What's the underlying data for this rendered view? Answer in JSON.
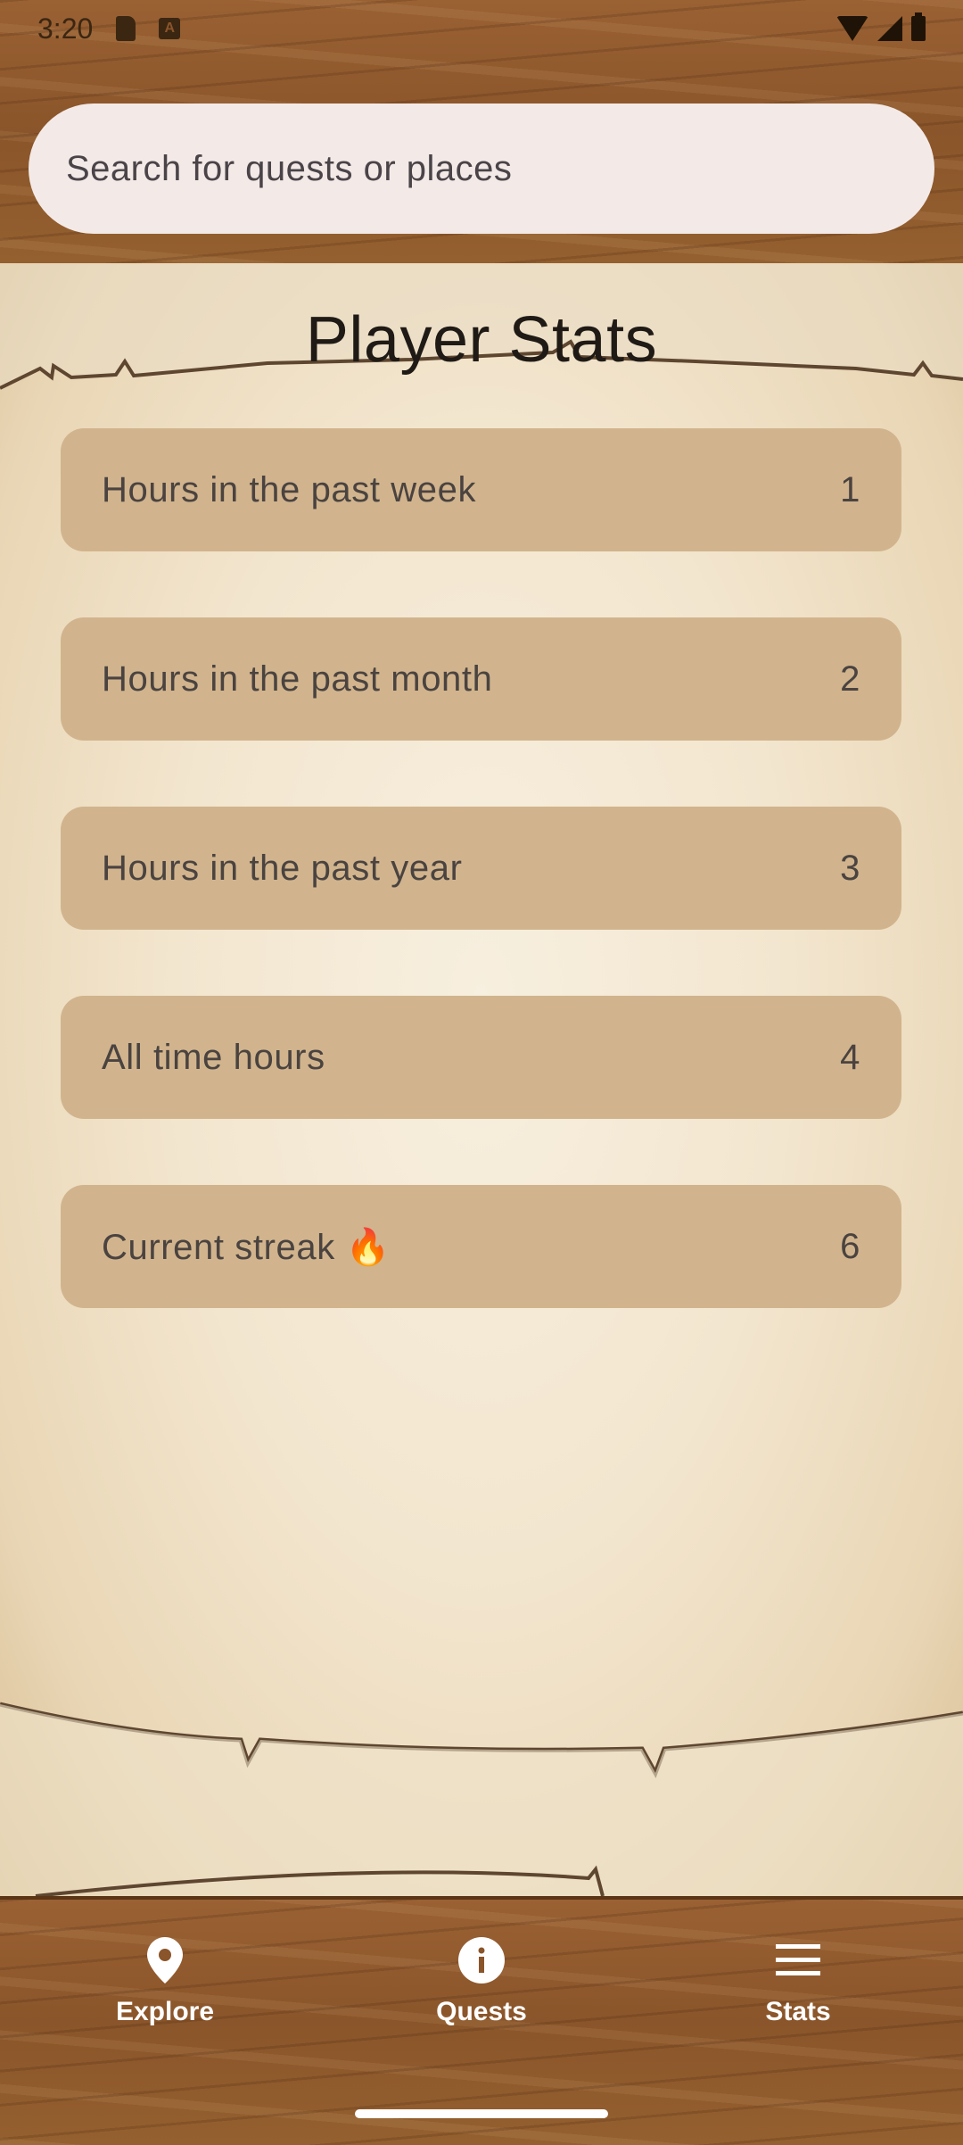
{
  "status_bar": {
    "time": "3:20"
  },
  "search": {
    "placeholder": "Search for quests or places"
  },
  "page": {
    "title": "Player Stats"
  },
  "stats": [
    {
      "label": "Hours in the past week",
      "value": "1"
    },
    {
      "label": "Hours in the past month",
      "value": "2"
    },
    {
      "label": "Hours in the past year",
      "value": "3"
    },
    {
      "label": "All time hours",
      "value": "4"
    },
    {
      "label": "Current streak 🔥",
      "value": "6"
    }
  ],
  "nav": {
    "items": [
      {
        "label": "Explore",
        "icon": "location-pin-icon"
      },
      {
        "label": "Quests",
        "icon": "info-icon"
      },
      {
        "label": "Stats",
        "icon": "menu-icon"
      }
    ]
  },
  "colors": {
    "wood": "#8a552a",
    "parchment": "#f3e6cf",
    "card": "#d1b48d",
    "search_bg": "#f3eae8"
  }
}
